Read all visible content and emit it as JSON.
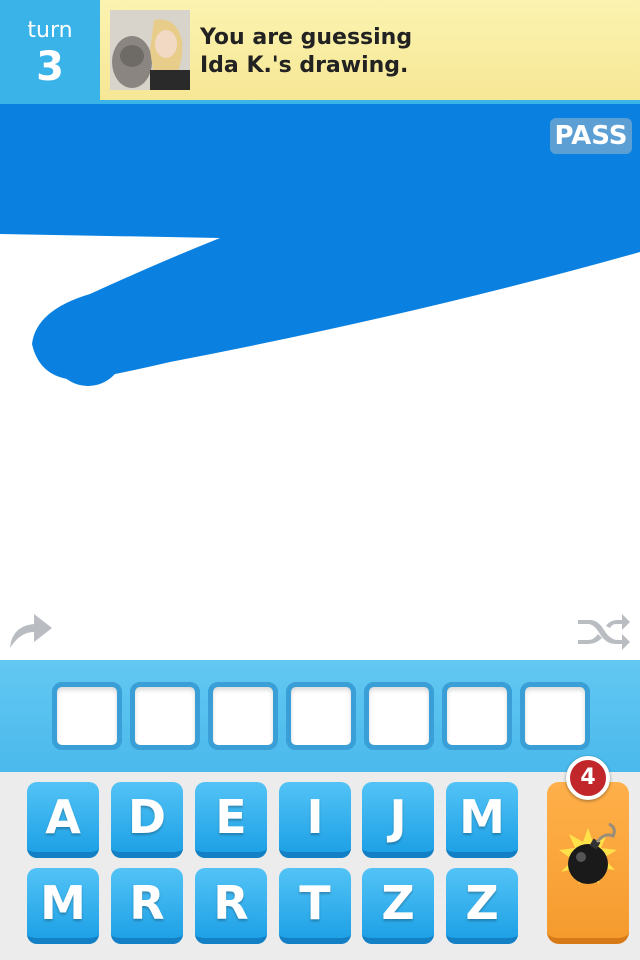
{
  "header": {
    "turn_label": "turn",
    "turn_number": "3",
    "line1": "You are guessing",
    "line2": "Ida K.'s drawing."
  },
  "canvas": {
    "pass_label": "PASS",
    "stroke_color": "#0a80e0"
  },
  "answer": {
    "slot_count": 7
  },
  "keyboard": {
    "row1": [
      "A",
      "D",
      "E",
      "I",
      "J",
      "M"
    ],
    "row2": [
      "M",
      "R",
      "R",
      "T",
      "Z",
      "Z"
    ],
    "bomb_count": "4"
  },
  "colors": {
    "accent": "#3ab3e8",
    "key_blue": "#1ea1e6",
    "bomb_orange": "#f59b2e",
    "badge_red": "#c0262a"
  },
  "icons": [
    "redo-icon",
    "shuffle-icon",
    "bomb-icon"
  ]
}
